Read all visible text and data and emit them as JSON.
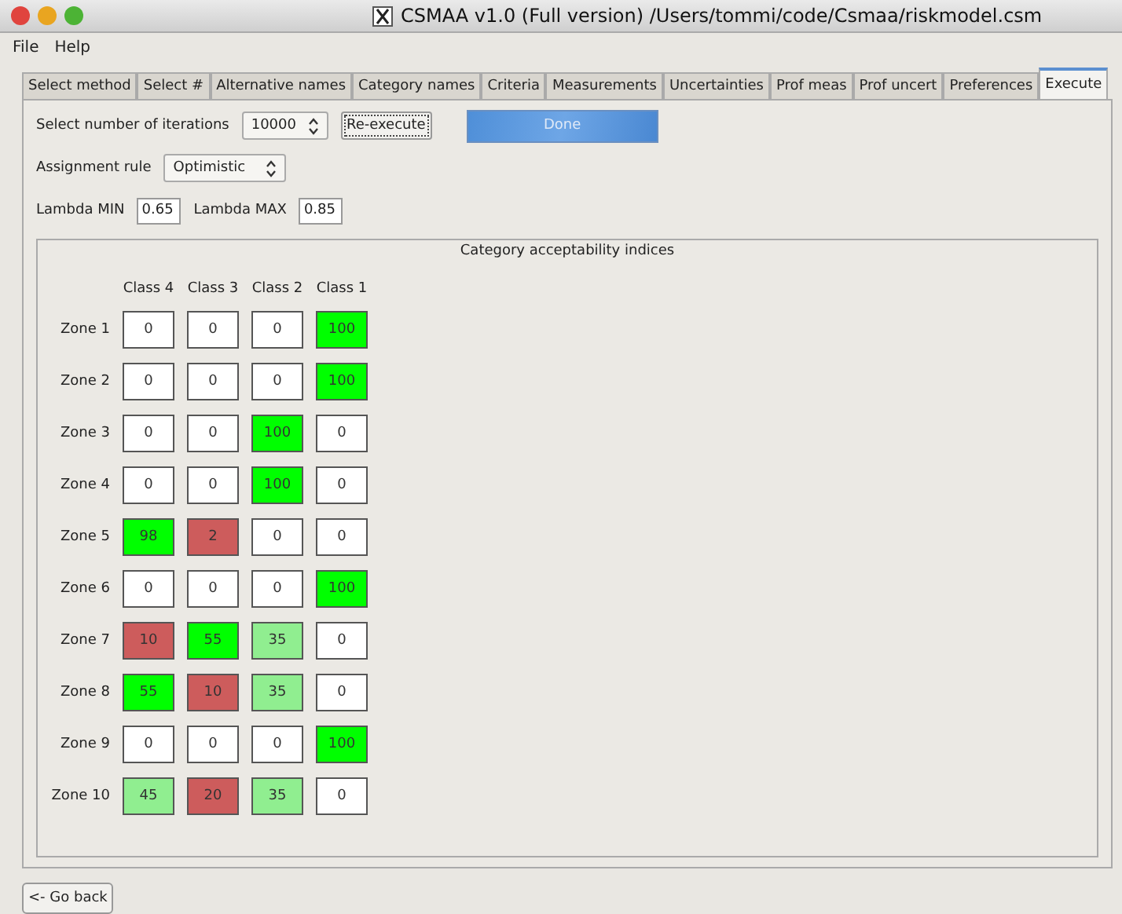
{
  "window": {
    "title": "CSMAA v1.0 (Full version) /Users/tommi/code/Csmaa/riskmodel.csm"
  },
  "menu": [
    "File",
    "Help"
  ],
  "tabs": [
    {
      "label": "Select method",
      "selected": false
    },
    {
      "label": "Select #",
      "selected": false
    },
    {
      "label": "Alternative names",
      "selected": false
    },
    {
      "label": "Category names",
      "selected": false
    },
    {
      "label": "Criteria",
      "selected": false
    },
    {
      "label": "Measurements",
      "selected": false
    },
    {
      "label": "Uncertainties",
      "selected": false
    },
    {
      "label": "Prof meas",
      "selected": false
    },
    {
      "label": "Prof uncert",
      "selected": false
    },
    {
      "label": "Preferences",
      "selected": false
    },
    {
      "label": "Execute",
      "selected": true
    }
  ],
  "iterations": {
    "label": "Select number of iterations",
    "value": "10000"
  },
  "reexecute_button": "Re-execute",
  "progress": {
    "label": "Done",
    "level": 1
  },
  "assignment_rule": {
    "label": "Assignment rule",
    "value": "Optimistic"
  },
  "lambda_min": {
    "label": "Lambda MIN",
    "value": "0.65"
  },
  "lambda_max": {
    "label": "Lambda MAX",
    "value": "0.85"
  },
  "table": {
    "title": "Category acceptability indices",
    "columns": [
      "Class 4",
      "Class 3",
      "Class 2",
      "Class 1"
    ],
    "rows": [
      {
        "name": "Zone 1",
        "cells": [
          {
            "value": "0",
            "color": "#ffffff"
          },
          {
            "value": "0",
            "color": "#ffffff"
          },
          {
            "value": "0",
            "color": "#ffffff"
          },
          {
            "value": "100",
            "color": "#00ff00"
          }
        ]
      },
      {
        "name": "Zone 2",
        "cells": [
          {
            "value": "0",
            "color": "#ffffff"
          },
          {
            "value": "0",
            "color": "#ffffff"
          },
          {
            "value": "0",
            "color": "#ffffff"
          },
          {
            "value": "100",
            "color": "#00ff00"
          }
        ]
      },
      {
        "name": "Zone 3",
        "cells": [
          {
            "value": "0",
            "color": "#ffffff"
          },
          {
            "value": "0",
            "color": "#ffffff"
          },
          {
            "value": "100",
            "color": "#00ff00"
          },
          {
            "value": "0",
            "color": "#ffffff"
          }
        ]
      },
      {
        "name": "Zone 4",
        "cells": [
          {
            "value": "0",
            "color": "#ffffff"
          },
          {
            "value": "0",
            "color": "#ffffff"
          },
          {
            "value": "100",
            "color": "#00ff00"
          },
          {
            "value": "0",
            "color": "#ffffff"
          }
        ]
      },
      {
        "name": "Zone 5",
        "cells": [
          {
            "value": "98",
            "color": "#00ff00"
          },
          {
            "value": "2",
            "color": "#cd5c5c"
          },
          {
            "value": "0",
            "color": "#ffffff"
          },
          {
            "value": "0",
            "color": "#ffffff"
          }
        ]
      },
      {
        "name": "Zone 6",
        "cells": [
          {
            "value": "0",
            "color": "#ffffff"
          },
          {
            "value": "0",
            "color": "#ffffff"
          },
          {
            "value": "0",
            "color": "#ffffff"
          },
          {
            "value": "100",
            "color": "#00ff00"
          }
        ]
      },
      {
        "name": "Zone 7",
        "cells": [
          {
            "value": "10",
            "color": "#cd5c5c"
          },
          {
            "value": "55",
            "color": "#00ff00"
          },
          {
            "value": "35",
            "color": "#90ee90"
          },
          {
            "value": "0",
            "color": "#ffffff"
          }
        ]
      },
      {
        "name": "Zone 8",
        "cells": [
          {
            "value": "55",
            "color": "#00ff00"
          },
          {
            "value": "10",
            "color": "#cd5c5c"
          },
          {
            "value": "35",
            "color": "#90ee90"
          },
          {
            "value": "0",
            "color": "#ffffff"
          }
        ]
      },
      {
        "name": "Zone 9",
        "cells": [
          {
            "value": "0",
            "color": "#ffffff"
          },
          {
            "value": "0",
            "color": "#ffffff"
          },
          {
            "value": "0",
            "color": "#ffffff"
          },
          {
            "value": "100",
            "color": "#00ff00"
          }
        ]
      },
      {
        "name": "Zone 10",
        "cells": [
          {
            "value": "45",
            "color": "#90ee90"
          },
          {
            "value": "20",
            "color": "#cd5c5c"
          },
          {
            "value": "35",
            "color": "#90ee90"
          },
          {
            "value": "0",
            "color": "#ffffff"
          }
        ]
      }
    ]
  },
  "back_button": "<- Go back"
}
